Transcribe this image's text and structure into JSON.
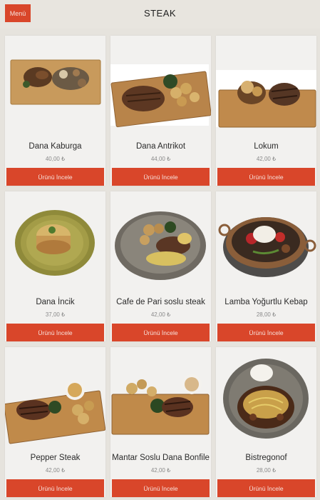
{
  "header": {
    "menu_label": "Menü",
    "title": "STEAK"
  },
  "products": [
    {
      "name": "Dana Kaburga",
      "price": "40,00 ₺",
      "button": "Ürünü İncele",
      "image": "ribs-on-wood-board"
    },
    {
      "name": "Dana Antrikot",
      "price": "44,00 ₺",
      "button": "Ürünü İncele",
      "image": "steak-on-wood-board"
    },
    {
      "name": "Lokum",
      "price": "42,00 ₺",
      "button": "Ürünü İncele",
      "image": "steak-on-wood-board"
    },
    {
      "name": "Dana İncik",
      "price": "37,00 ₺",
      "button": "Ürünü İncele",
      "image": "pastry-on-plate"
    },
    {
      "name": "Cafe de Pari soslu steak",
      "price": "42,00 ₺",
      "button": "Ürünü İncele",
      "image": "steak-on-gray-plate"
    },
    {
      "name": "Lamba Yoğurtlu Kebap",
      "price": "28,00 ₺",
      "button": "Ürünü İncele",
      "image": "kebab-in-pan"
    },
    {
      "name": "Pepper Steak",
      "price": "42,00 ₺",
      "button": "Ürünü İncele",
      "image": "steak-on-wood-board"
    },
    {
      "name": "Mantar Soslu Dana Bonfile",
      "price": "42,00 ₺",
      "button": "Ürünü İncele",
      "image": "steak-on-wood-board"
    },
    {
      "name": "Bistregonof",
      "price": "28,00 ₺",
      "button": "Ürünü İncele",
      "image": "stroganoff-on-plate"
    }
  ],
  "colors": {
    "accent": "#d9462a",
    "background": "#e6e3dd",
    "card": "#f2f1ef"
  }
}
